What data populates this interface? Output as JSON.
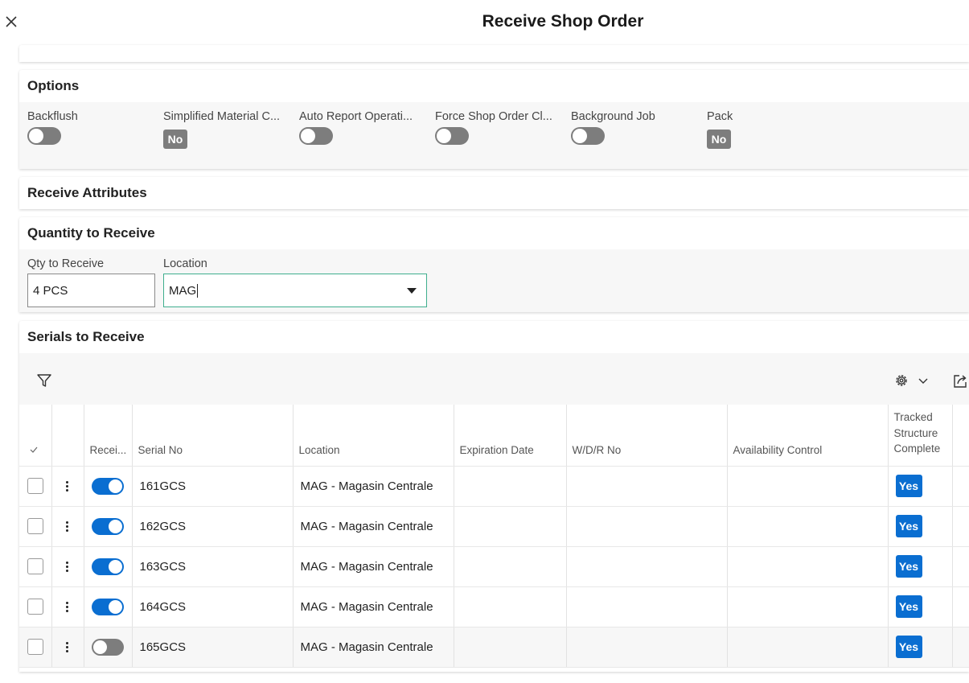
{
  "dialog": {
    "title": "Receive Shop Order"
  },
  "options": {
    "header": "Options",
    "items": [
      {
        "label": "Backflush",
        "kind": "toggle",
        "on": false
      },
      {
        "label": "Simplified Material C...",
        "kind": "badge",
        "value": "No"
      },
      {
        "label": "Auto Report Operati...",
        "kind": "toggle",
        "on": false
      },
      {
        "label": "Force Shop Order Cl...",
        "kind": "toggle",
        "on": false
      },
      {
        "label": "Background Job",
        "kind": "toggle",
        "on": false
      },
      {
        "label": "Pack",
        "kind": "badge",
        "value": "No"
      }
    ]
  },
  "receive_attributes": {
    "header": "Receive Attributes"
  },
  "quantity": {
    "header": "Quantity to Receive",
    "qty_label": "Qty to Receive",
    "qty_value": "4 PCS",
    "location_label": "Location",
    "location_value": "MAG"
  },
  "serials": {
    "header": "Serials to Receive",
    "columns": {
      "received": "Recei...",
      "serial_no": "Serial No",
      "location": "Location",
      "expiration_date": "Expiration Date",
      "wdr_no": "W/D/R No",
      "availability_control": "Availability Control",
      "tracked_structure_complete": "Tracked Structure Complete"
    },
    "rows": [
      {
        "received": true,
        "serial_no": "161GCS",
        "location": "MAG - Magasin Centrale",
        "expiration_date": "",
        "wdr_no": "",
        "availability_control": "",
        "tracked": "Yes"
      },
      {
        "received": true,
        "serial_no": "162GCS",
        "location": "MAG - Magasin Centrale",
        "expiration_date": "",
        "wdr_no": "",
        "availability_control": "",
        "tracked": "Yes"
      },
      {
        "received": true,
        "serial_no": "163GCS",
        "location": "MAG - Magasin Centrale",
        "expiration_date": "",
        "wdr_no": "",
        "availability_control": "",
        "tracked": "Yes"
      },
      {
        "received": true,
        "serial_no": "164GCS",
        "location": "MAG - Magasin Centrale",
        "expiration_date": "",
        "wdr_no": "",
        "availability_control": "",
        "tracked": "Yes"
      },
      {
        "received": false,
        "serial_no": "165GCS",
        "location": "MAG - Magasin Centrale",
        "expiration_date": "",
        "wdr_no": "",
        "availability_control": "",
        "tracked": "Yes"
      }
    ]
  },
  "icons": {
    "close": "close-icon",
    "filter": "filter-icon",
    "settings": "gear-icon",
    "dropdown": "chevron-down-icon",
    "export": "export-icon",
    "check": "check-icon",
    "row_menu": "more-vertical-icon"
  },
  "colors": {
    "accent": "#0a6ed1",
    "toggle_off": "#7d7d7d",
    "badge_no": "#7d7d7d",
    "focus_border": "#3fae8e"
  }
}
